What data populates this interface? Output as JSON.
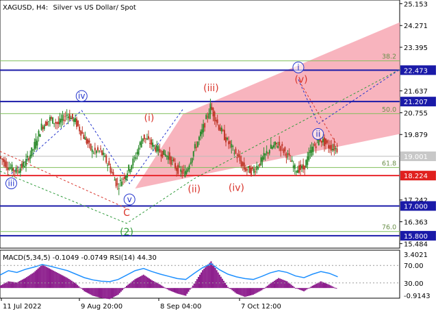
{
  "header": {
    "symbol": "XAGUSD, H4:",
    "description": "Silver vs US Dollar/ Spot"
  },
  "colors": {
    "level_blue": "#1a1aa8",
    "level_red": "#e8262c",
    "fib_green": "#7fbf5a",
    "channel_pink": "#f7a7b3",
    "wave_red": "#d9342b",
    "wave_green": "#2e9a3a",
    "wave_blue": "#2233cc",
    "macd_hist": "#8b1a8b",
    "rsi_line": "#1e90ff",
    "badge_blue": "#1a1aa8",
    "badge_red": "#e0201e",
    "badge_gray": "#c8c8c8"
  },
  "chart_data": [
    {
      "type": "line",
      "subtype": "candlestick",
      "ylim": [
        15.3,
        25.3
      ],
      "y_tick_labels": [
        "25.153",
        "24.271",
        "23.395",
        "22.473",
        "21.637",
        "21.207",
        "20.755",
        "19.879",
        "19.001",
        "18.224",
        "17.242",
        "17.000",
        "16.363",
        "15.800",
        "15.484"
      ],
      "x_tick_labels": [
        "11 Jul 2022",
        "9 Aug 20:00",
        "8 Sep 04:00",
        "7 Oct 12:00"
      ],
      "x": [
        0,
        3,
        6,
        9,
        12,
        15,
        18,
        21,
        24,
        27,
        30,
        33,
        36,
        39,
        42,
        45,
        48,
        51,
        54,
        57,
        60,
        63,
        66,
        69,
        72,
        75,
        78,
        81,
        84,
        87,
        90,
        93,
        96,
        99,
        102,
        105,
        108,
        111,
        114,
        117,
        120
      ],
      "price": [
        19.0,
        18.6,
        18.4,
        18.7,
        19.3,
        20.2,
        20.5,
        20.3,
        20.7,
        20.4,
        19.8,
        19.2,
        19.2,
        18.6,
        17.8,
        18.3,
        18.9,
        19.8,
        19.5,
        19.2,
        19.0,
        18.5,
        18.3,
        19.2,
        20.0,
        21.0,
        20.2,
        19.6,
        19.1,
        18.5,
        18.4,
        18.8,
        19.3,
        19.5,
        19.1,
        18.5,
        18.5,
        19.3,
        19.7,
        19.4,
        19.3
      ],
      "current_price": "19.001",
      "levels": [
        {
          "label": "22.473",
          "value": 22.473,
          "style": "blue",
          "badge": true
        },
        {
          "label": "21.207",
          "value": 21.207,
          "style": "blue",
          "badge": true
        },
        {
          "label": "18.224",
          "value": 18.224,
          "style": "red",
          "badge": true
        },
        {
          "label": "17.000",
          "value": 17.0,
          "style": "blue",
          "badge": true
        },
        {
          "label": "15.800",
          "value": 15.8,
          "style": "blue",
          "badge": true
        }
      ],
      "fib_levels": [
        {
          "label": "38.2",
          "value": 22.85
        },
        {
          "label": "50.0",
          "value": 20.72
        },
        {
          "label": "61.8",
          "value": 18.55
        },
        {
          "label": "76.0",
          "value": 15.97
        }
      ],
      "wave_labels": [
        {
          "text": "(i)",
          "color": "red",
          "x": 53,
          "value": 20.42
        },
        {
          "text": "(iii)",
          "color": "red",
          "x": 75,
          "value": 21.63
        },
        {
          "text": "(ii)",
          "color": "red",
          "x": 69,
          "value": 17.55
        },
        {
          "text": "(iv)",
          "color": "red",
          "x": 84,
          "value": 17.6
        },
        {
          "text": "(v)",
          "color": "red",
          "x": 107,
          "value": 21.97
        },
        {
          "text": "C",
          "color": "red",
          "x": 45,
          "value": 16.6
        },
        {
          "text": "(2)",
          "color": "green",
          "x": 45,
          "value": 15.82
        },
        {
          "text": "iii",
          "color": "blue",
          "x": 4,
          "value": 17.8
        },
        {
          "text": "iv",
          "color": "blue",
          "x": 29,
          "value": 21.32
        },
        {
          "text": "v",
          "color": "blue",
          "x": 46,
          "value": 17.15
        },
        {
          "text": "i",
          "color": "blue",
          "x": 106,
          "value": 22.473
        },
        {
          "text": "ii",
          "color": "blue",
          "x": 113,
          "value": 19.79
        }
      ]
    },
    {
      "type": "line",
      "subtype": "indicators",
      "label": "MACD(5,34,5) -0.1049 -0.0749 RSI(14) 44.30",
      "y_tick_labels": [
        "3.4021",
        "70.00",
        "30.00",
        "-0.9143"
      ],
      "ylim": [
        -0.9143,
        3.4021
      ],
      "macd_hist": [
        0.2,
        0.6,
        0.5,
        0.9,
        1.4,
        2.1,
        1.7,
        1.3,
        0.9,
        0.4,
        -0.3,
        -0.7,
        -0.9,
        -1.0,
        -0.6,
        0.2,
        0.8,
        1.2,
        0.7,
        0.3,
        -0.2,
        -0.5,
        -0.7,
        0.4,
        1.6,
        2.4,
        1.2,
        0.1,
        -0.5,
        -0.8,
        -0.6,
        -0.2,
        0.4,
        0.9,
        0.6,
        0.0,
        -0.3,
        0.2,
        0.6,
        0.3,
        -0.1
      ],
      "rsi": [
        48,
        58,
        54,
        61,
        66,
        72,
        68,
        63,
        58,
        50,
        42,
        37,
        34,
        33,
        38,
        48,
        58,
        63,
        56,
        50,
        45,
        40,
        38,
        52,
        65,
        74,
        60,
        50,
        44,
        40,
        38,
        45,
        53,
        58,
        54,
        46,
        42,
        50,
        56,
        52,
        44
      ]
    }
  ]
}
